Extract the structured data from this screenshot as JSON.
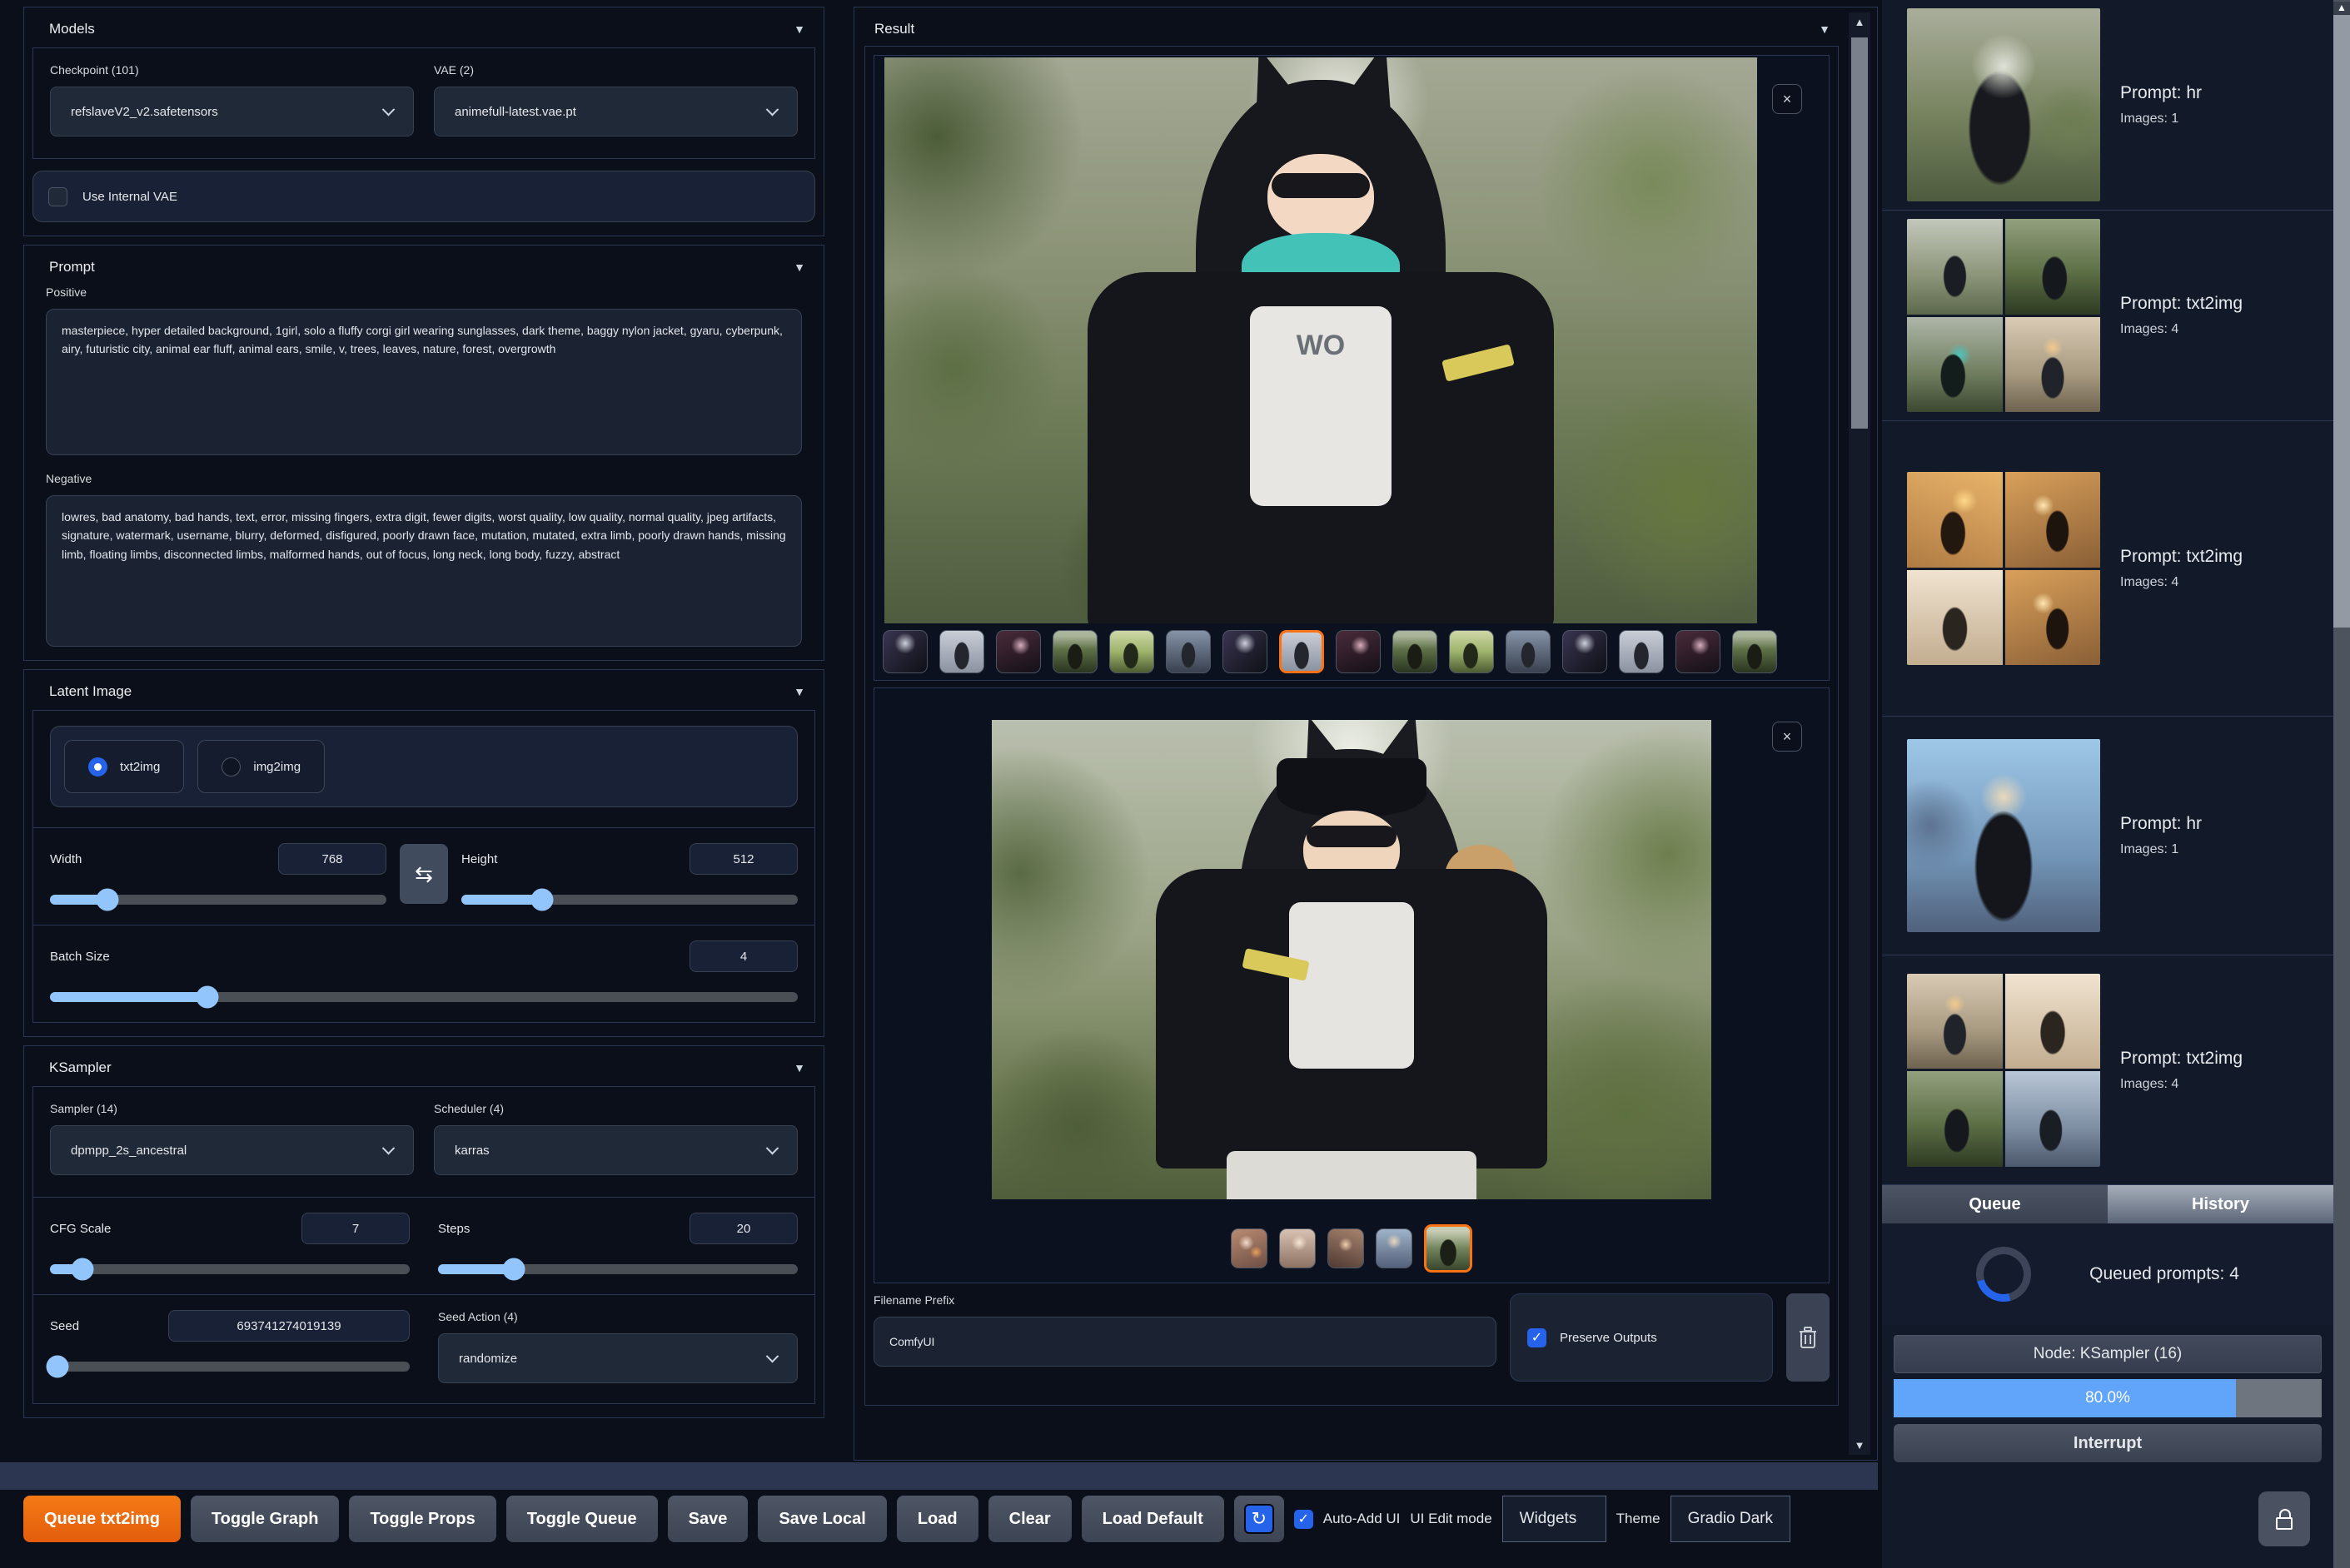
{
  "left_panel": {
    "models": {
      "title": "Models",
      "checkpoint_label": "Checkpoint (101)",
      "checkpoint_value": "refslaveV2_v2.safetensors",
      "vae_label": "VAE (2)",
      "vae_value": "animefull-latest.vae.pt",
      "use_internal_vae_label": "Use Internal VAE",
      "use_internal_vae_checked": false
    },
    "prompt": {
      "title": "Prompt",
      "positive_label": "Positive",
      "positive_value": "masterpiece, hyper detailed background, 1girl, solo a fluffy corgi girl wearing sunglasses, dark theme, baggy nylon jacket, gyaru, cyberpunk, airy, futuristic city, animal ear fluff, animal ears, smile, v, trees, leaves, nature, forest, overgrowth",
      "negative_label": "Negative",
      "negative_value": "lowres, bad anatomy, bad hands, text, error, missing fingers, extra digit, fewer digits, worst quality, low quality, normal quality, jpeg artifacts, signature, watermark, username, blurry, deformed, disfigured, poorly drawn face, mutation, mutated, extra limb, poorly drawn hands, missing limb, floating limbs, disconnected limbs, malformed hands, out of focus, long neck, long body, fuzzy, abstract"
    },
    "latent": {
      "title": "Latent Image",
      "mode_options": [
        "txt2img",
        "img2img"
      ],
      "mode_selected": "txt2img",
      "width_label": "Width",
      "width_value": "768",
      "height_label": "Height",
      "height_value": "512",
      "batch_label": "Batch Size",
      "batch_value": "4",
      "swap_icon": "⇆"
    },
    "ksampler": {
      "title": "KSampler",
      "sampler_label": "Sampler (14)",
      "sampler_value": "dpmpp_2s_ancestral",
      "scheduler_label": "Scheduler (4)",
      "scheduler_value": "karras",
      "cfg_label": "CFG Scale",
      "cfg_value": "7",
      "steps_label": "Steps",
      "steps_value": "20",
      "seed_label": "Seed",
      "seed_value": "693741274019139",
      "seed_action_label": "Seed Action (4)",
      "seed_action_value": "randomize"
    }
  },
  "result_panel": {
    "title": "Result",
    "close_icon": "×",
    "gallery1": {
      "count": 16,
      "selected": 8
    },
    "gallery2": {
      "count": 5,
      "selected": 5
    },
    "filename_prefix_label": "Filename Prefix",
    "filename_prefix_value": "ComfyUI",
    "preserve_outputs_label": "Preserve Outputs",
    "preserve_outputs_checked": true
  },
  "sidebar": {
    "history": [
      {
        "prompt": "Prompt: hr",
        "images": "Images: 1"
      },
      {
        "prompt": "Prompt: txt2img",
        "images": "Images: 4"
      },
      {
        "prompt": "Prompt: txt2img",
        "images": "Images: 4"
      },
      {
        "prompt": "Prompt: hr",
        "images": "Images: 1"
      },
      {
        "prompt": "Prompt: txt2img",
        "images": "Images: 4"
      }
    ],
    "tabs": {
      "queue": "Queue",
      "history": "History"
    },
    "active_tab": "History",
    "queued_text": "Queued prompts: 4",
    "node_text": "Node: KSampler (16)",
    "progress_text": "80.0%",
    "progress_percent": 80,
    "interrupt_label": "Interrupt"
  },
  "toolbar": {
    "queue_button": "Queue txt2img",
    "toggle_graph": "Toggle Graph",
    "toggle_props": "Toggle Props",
    "toggle_queue": "Toggle Queue",
    "save": "Save",
    "save_local": "Save Local",
    "load": "Load",
    "clear": "Clear",
    "load_default": "Load Default",
    "refresh_icon": "↻",
    "auto_add_ui_label": "Auto-Add UI",
    "auto_add_ui_checked": true,
    "ui_edit_mode_label": "UI Edit mode",
    "widgets_value": "Widgets",
    "theme_label": "Theme",
    "theme_value": "Gradio Dark",
    "check_glyph": "✓"
  },
  "colors": {
    "accent_orange": "#f97316",
    "accent_blue": "#2563eb",
    "slider_blue": "#93c5fd",
    "progress_blue": "#60a5fa",
    "background": "#0b0f19"
  }
}
